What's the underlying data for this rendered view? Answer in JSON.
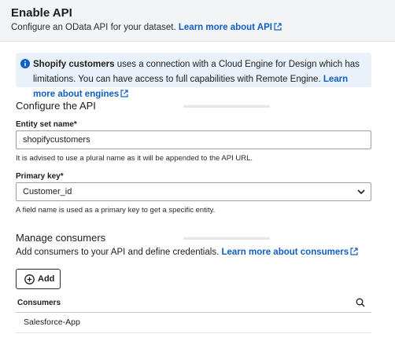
{
  "header": {
    "title": "Enable API",
    "subtitle": "Configure an OData API for your dataset.",
    "learn_more": "Learn more about API"
  },
  "banner": {
    "entity": "Shopify customers",
    "message": "uses a connection with a Cloud Engine for Design which has limitations. You can have access to full capabilities with Remote Engine.",
    "link": "Learn more about engines",
    "accent": "#0f5fc3"
  },
  "configure": {
    "title": "Configure the API",
    "entity_label": "Entity set name*",
    "entity_value": "shopifycustomers",
    "entity_hint": "It is advised to use a plural name as it will be appended to the API URL.",
    "primary_label": "Primary key*",
    "primary_value": "Customer_id",
    "primary_hint": "A field name is used as a primary key to get a specific entity."
  },
  "consumers": {
    "title": "Manage consumers",
    "description": "Add consumers to your API and define credentials.",
    "link": "Learn more about consumers",
    "add_label": "Add",
    "column_header": "Consumers",
    "rows": [
      "Salesforce-App"
    ]
  }
}
